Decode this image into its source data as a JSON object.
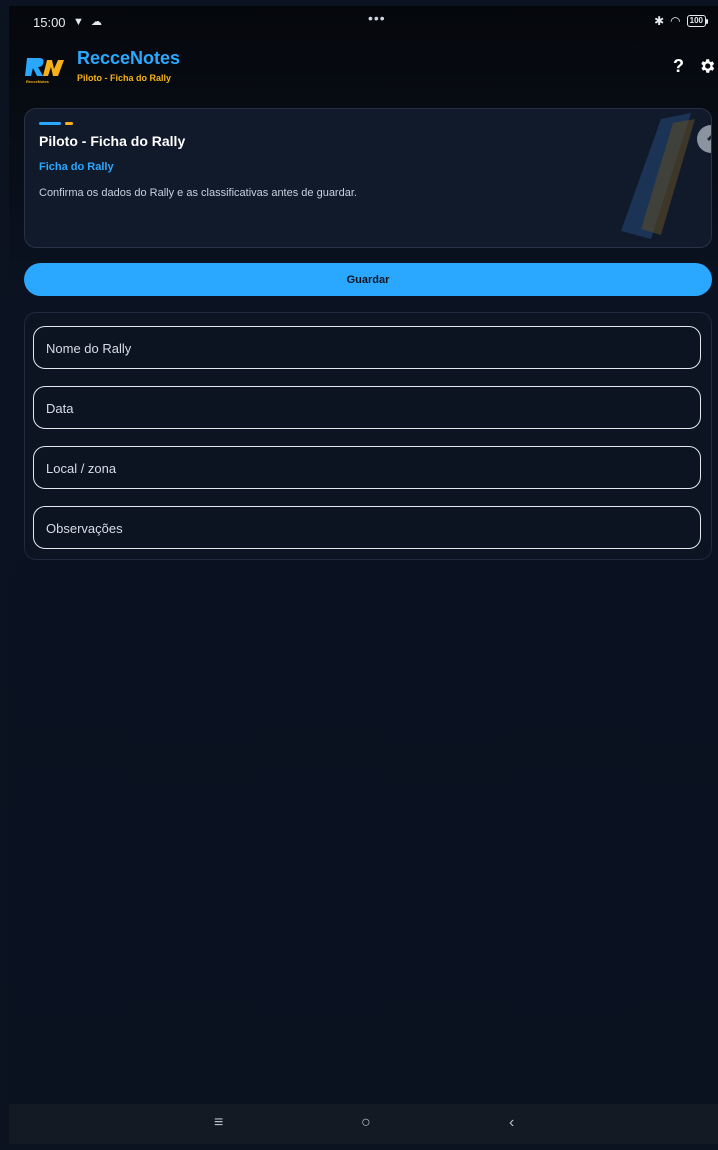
{
  "status_bar": {
    "time": "15:00",
    "battery": "100"
  },
  "app_bar": {
    "title": "RecceNotes",
    "subtitle": "Piloto - Ficha do Rally",
    "logo_text": "RecceNotes",
    "help_label": "?"
  },
  "header_card": {
    "title": "Piloto - Ficha do Rally",
    "subtitle": "Ficha do Rally",
    "description": "Confirma os dados do Rally e as classificativas antes de guardar."
  },
  "actions": {
    "save_label": "Guardar"
  },
  "form": {
    "fields": [
      {
        "placeholder": "Nome do Rally",
        "value": ""
      },
      {
        "placeholder": "Data",
        "value": ""
      },
      {
        "placeholder": "Local / zona",
        "value": ""
      },
      {
        "placeholder": "Observações",
        "value": ""
      }
    ]
  },
  "colors": {
    "accent_blue": "#2aa7ff",
    "accent_amber": "#f6b11a",
    "background": "#0b1220"
  },
  "icons": [
    "wifi-icon",
    "bluetooth-icon",
    "battery-icon",
    "help-icon",
    "gear-icon",
    "menu-icon",
    "home-icon",
    "back-icon"
  ]
}
